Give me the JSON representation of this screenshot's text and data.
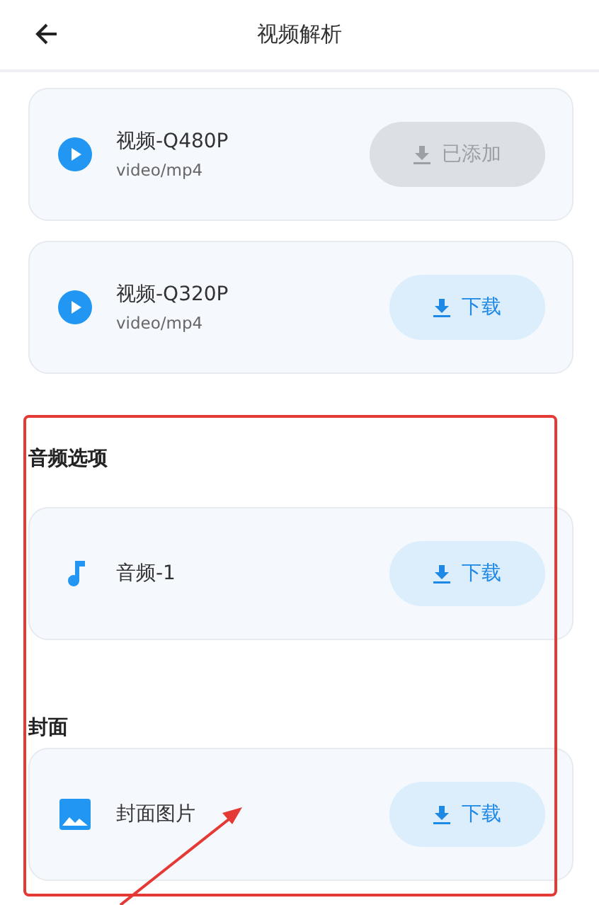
{
  "header": {
    "title": "视频解析"
  },
  "sections": [
    {
      "items": [
        {
          "kind": "video",
          "title": "视频-Q480P",
          "subtitle": "video/mp4",
          "button": {
            "label": "已添加",
            "added": true
          }
        },
        {
          "kind": "video",
          "title": "视频-Q320P",
          "subtitle": "video/mp4",
          "button": {
            "label": "下载",
            "added": false
          }
        }
      ]
    },
    {
      "heading": "音频选项",
      "items": [
        {
          "kind": "audio",
          "title": "音频-1",
          "button": {
            "label": "下载",
            "added": false
          }
        }
      ]
    },
    {
      "heading": "封面",
      "items": [
        {
          "kind": "image",
          "title": "封面图片",
          "button": {
            "label": "下载",
            "added": false
          }
        }
      ]
    }
  ]
}
